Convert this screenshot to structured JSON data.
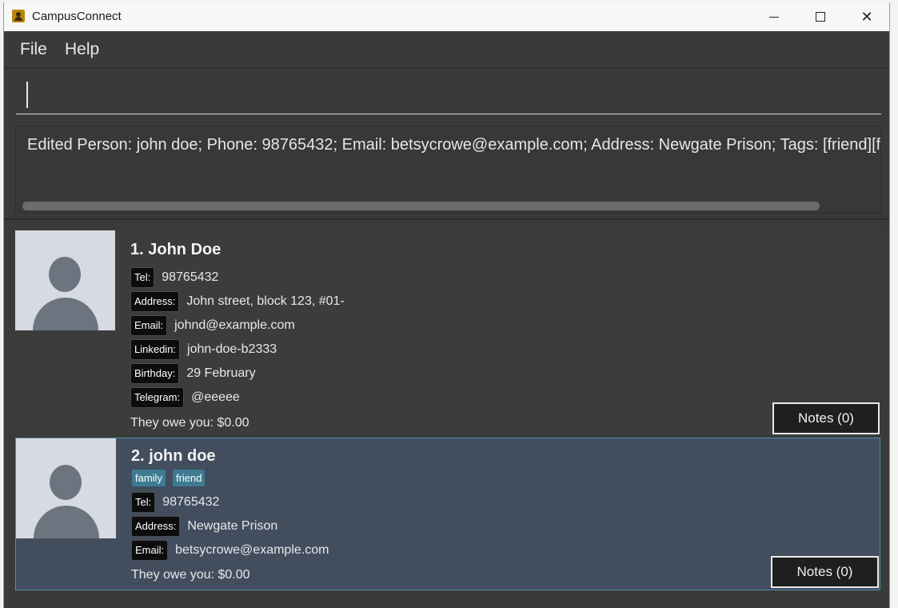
{
  "window": {
    "title": "CampusConnect"
  },
  "menu": {
    "file": "File",
    "help": "Help"
  },
  "command": {
    "value": "",
    "placeholder": ""
  },
  "result": {
    "text": "Edited Person: john doe; Phone: 98765432; Email: betsycrowe@example.com; Address: Newgate Prison; Tags: [friend][family]"
  },
  "persons": [
    {
      "index_name": "1.  John Doe",
      "tags": [],
      "fields": [
        {
          "label": "Tel:",
          "value": "98765432"
        },
        {
          "label": "Address:",
          "value": "John street, block 123, #01-"
        },
        {
          "label": "Email:",
          "value": "johnd@example.com"
        },
        {
          "label": "Linkedin:",
          "value": "john-doe-b2333"
        },
        {
          "label": "Birthday:",
          "value": "29 February"
        },
        {
          "label": "Telegram:",
          "value": "@eeeee"
        }
      ],
      "owe": "They owe you: $0.00",
      "notes": "Notes (0)"
    },
    {
      "index_name": "2.  john doe",
      "tags": [
        "family",
        "friend"
      ],
      "fields": [
        {
          "label": "Tel:",
          "value": "98765432"
        },
        {
          "label": "Address:",
          "value": "Newgate Prison"
        },
        {
          "label": "Email:",
          "value": "betsycrowe@example.com"
        }
      ],
      "owe": "They owe you: $0.00",
      "notes": "Notes (0)"
    }
  ],
  "colors": {
    "background": "#3a3a3a",
    "selected_card": "#424d5e",
    "tag": "#3e7b91",
    "label": "#0d0d0d"
  },
  "icons": {
    "app": "app-icon",
    "minimize": "minimize-icon",
    "maximize": "maximize-icon",
    "close": "close-icon",
    "avatar": "person-avatar-icon"
  }
}
